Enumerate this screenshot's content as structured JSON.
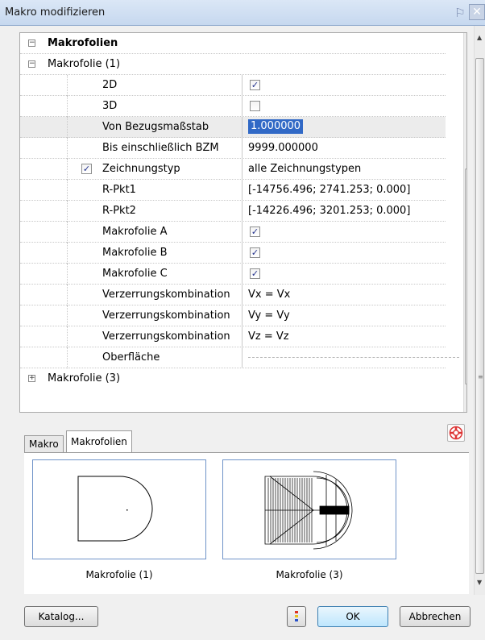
{
  "window": {
    "title": "Makro modifizieren"
  },
  "tree": {
    "root_label": "Makrofolien",
    "group1_label": "Makrofolie (1)",
    "group3_label": "Makrofolie (3)",
    "props": [
      {
        "name": "2D",
        "type": "checkbox",
        "checked": true
      },
      {
        "name": "3D",
        "type": "checkbox",
        "checked": false
      },
      {
        "name": "Von Bezugsmaßstab",
        "type": "text",
        "value": "1.000000",
        "selected": true
      },
      {
        "name": "Bis einschließlich BZM",
        "type": "text",
        "value": "9999.000000"
      },
      {
        "name": "Zeichnungstyp",
        "type": "text",
        "value": "alle Zeichnungstypen",
        "row_checkbox": true
      },
      {
        "name": "R-Pkt1",
        "type": "text",
        "value": "[-14756.496; 2741.253; 0.000]"
      },
      {
        "name": "R-Pkt2",
        "type": "text",
        "value": "[-14226.496; 3201.253; 0.000]"
      },
      {
        "name": "Makrofolie A",
        "type": "checkbox",
        "checked": true
      },
      {
        "name": "Makrofolie B",
        "type": "checkbox",
        "checked": true
      },
      {
        "name": "Makrofolie C",
        "type": "checkbox",
        "checked": true
      },
      {
        "name": "Verzerrungskombination",
        "type": "text",
        "value": "Vx = Vx"
      },
      {
        "name": "Verzerrungskombination",
        "type": "text",
        "value": "Vy = Vy"
      },
      {
        "name": "Verzerrungskombination",
        "type": "text",
        "value": "Vz = Vz"
      },
      {
        "name": "Oberfläche",
        "type": "dashed",
        "value": ""
      }
    ]
  },
  "tabs": [
    {
      "label": "Makro",
      "active": false
    },
    {
      "label": "Makrofolien",
      "active": true
    }
  ],
  "thumbnails": [
    {
      "caption": "Makrofolie (1)"
    },
    {
      "caption": "Makrofolie (3)"
    }
  ],
  "buttons": {
    "catalog": "Katalog...",
    "ok": "OK",
    "cancel": "Abbrechen"
  },
  "colors": {
    "selection": "#3169c6",
    "checkmark": "#22318c",
    "thumb_border": "#6f93c8"
  }
}
